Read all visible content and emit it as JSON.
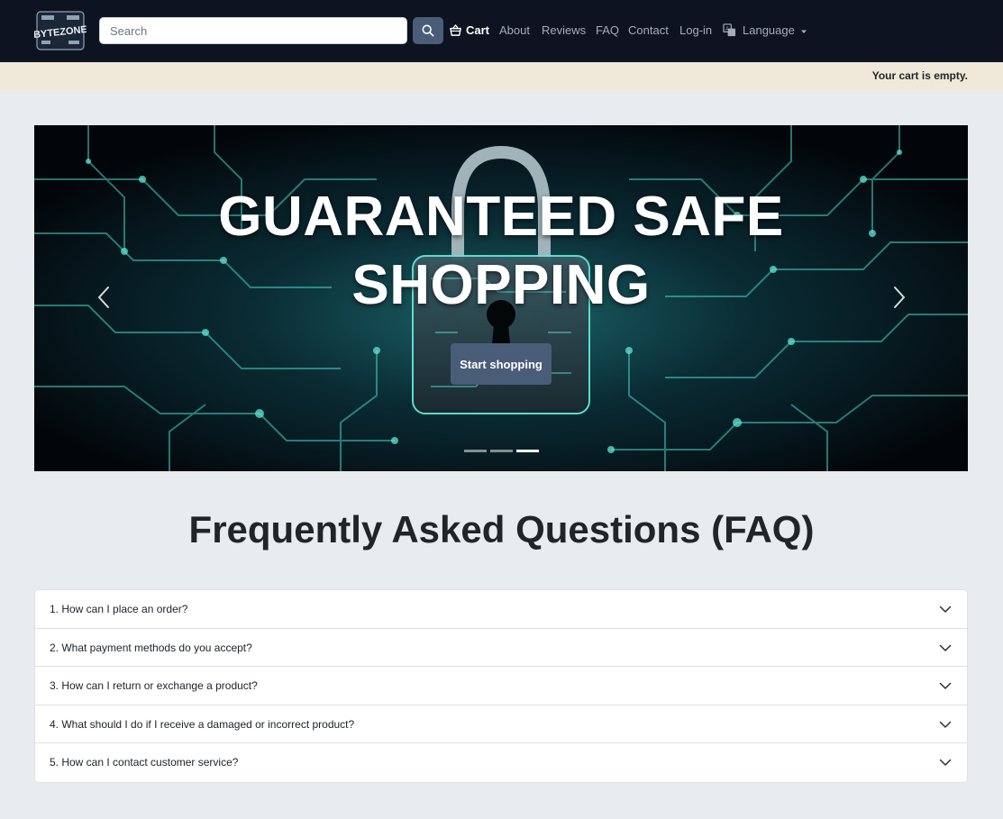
{
  "brand": {
    "logo_text": "BYTEZONE"
  },
  "search": {
    "placeholder": "Search"
  },
  "nav": {
    "cart": "Cart",
    "about": "About",
    "reviews": "Reviews",
    "faq": "FAQ",
    "contact": "Contact",
    "login": "Log-in",
    "language": "Language"
  },
  "notice": {
    "cart_status": "Your cart is empty."
  },
  "hero": {
    "title_line1": "GUARANTEED SAFE",
    "title_line2": "SHOPPING",
    "button": "Start shopping",
    "slides": 3,
    "active_slide": 3
  },
  "faq": {
    "title": "Frequently Asked Questions (FAQ)",
    "items": [
      {
        "question": "1. How can I place an order?"
      },
      {
        "question": "2. What payment methods do you accept?"
      },
      {
        "question": "3. How can I return or exchange a product?"
      },
      {
        "question": "4. What should I do if I receive a damaged or incorrect product?"
      },
      {
        "question": "5. How can I contact customer service?"
      }
    ]
  },
  "colors": {
    "navbar_bg": "#0d1320",
    "notice_bg": "#f0e8d8",
    "accent": "#4a5d78",
    "circuit": "#3fd1c4"
  }
}
